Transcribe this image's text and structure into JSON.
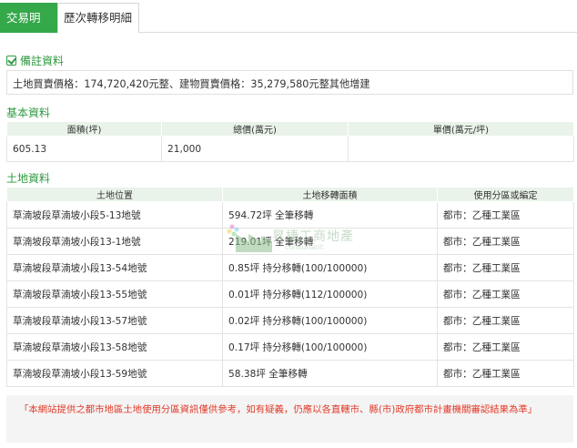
{
  "tabs": [
    {
      "label": "交易明細"
    },
    {
      "label": "歷次轉移明細"
    }
  ],
  "remark": {
    "title": "備註資料",
    "text": "土地買賣價格：174,720,420元整、建物買賣價格：35,279,580元整其他增建"
  },
  "basic": {
    "title": "基本資料",
    "headers": [
      "面積(坪)",
      "總價(萬元)",
      "單價(萬元/坪)"
    ],
    "row": [
      "605.13",
      "21,000",
      ""
    ]
  },
  "land": {
    "title": "土地資料",
    "headers": [
      "土地位置",
      "土地移轉面積",
      "使用分區或編定"
    ],
    "rows": [
      [
        "草湳坡段草湳坡小段5-13地號",
        "594.72坪 全筆移轉",
        "都市：乙種工業區"
      ],
      [
        "草湳坡段草湳坡小段13-1地號",
        "219.01坪 全筆移轉",
        "都市：乙種工業區"
      ],
      [
        "草湳坡段草湳坡小段13-54地號",
        "0.85坪 持分移轉(100/100000)",
        "都市：乙種工業區"
      ],
      [
        "草湳坡段草湳坡小段13-55地號",
        "0.01坪 持分移轉(112/100000)",
        "都市：乙種工業區"
      ],
      [
        "草湳坡段草湳坡小段13-57地號",
        "0.02坪 持分移轉(100/100000)",
        "都市：乙種工業區"
      ],
      [
        "草湳坡段草湳坡小段13-58地號",
        "0.17坪 持分移轉(100/100000)",
        "都市：乙種工業區"
      ],
      [
        "草湳坡段草湳坡小段13-59地號",
        "58.38坪 全筆移轉",
        "都市：乙種工業區"
      ]
    ]
  },
  "watermark": {
    "text": "昇捷工商地產",
    "sub": "consultant"
  },
  "notice": {
    "text": "「本網站提供之都市地區土地使用分區資訊僅供參考，如有疑義，仍應以各直轄市、縣(市)政府都市計畫機關審認結果為準」"
  },
  "colors": {
    "accent": "#35a84a",
    "header_bg": "#e9f3e9",
    "notice_text": "#e23a2a"
  }
}
